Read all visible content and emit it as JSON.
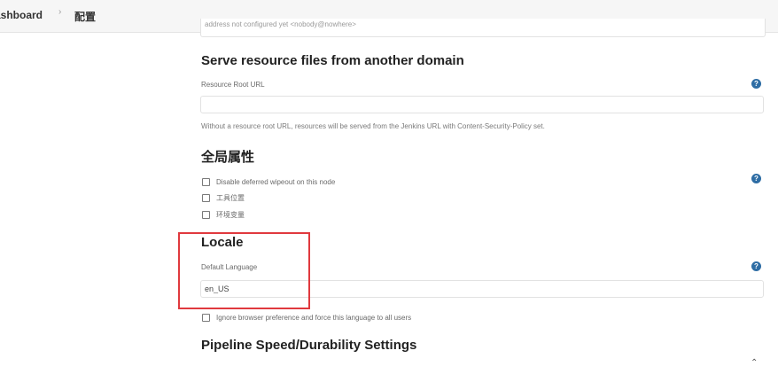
{
  "breadcrumb": {
    "dashboard": "ashboard",
    "separator": "›",
    "config": "配置"
  },
  "top_field": {
    "value": "address not configured yet <nobody@nowhere>"
  },
  "resource_root": {
    "title": "Serve resource files from another domain",
    "label": "Resource Root URL",
    "value": "",
    "hint": "Without a resource root URL, resources will be served from the Jenkins URL with Content-Security-Policy set."
  },
  "global_properties": {
    "title": "全局属性",
    "items": [
      {
        "label": "Disable deferred wipeout on this node",
        "checked": false
      },
      {
        "label": "工具位置",
        "checked": false
      },
      {
        "label": "环境变量",
        "checked": false
      }
    ]
  },
  "locale": {
    "title": "Locale",
    "label": "Default Language",
    "value": "en_US",
    "ignore_label": "Ignore browser preference and force this language to all users",
    "ignore_checked": false
  },
  "pipeline": {
    "title": "Pipeline Speed/Durability Settings"
  },
  "icons": {
    "help": "help-icon",
    "chevron": "chevron-up-icon"
  },
  "colors": {
    "help": "#2e6da4",
    "highlight": "#e0393e"
  }
}
